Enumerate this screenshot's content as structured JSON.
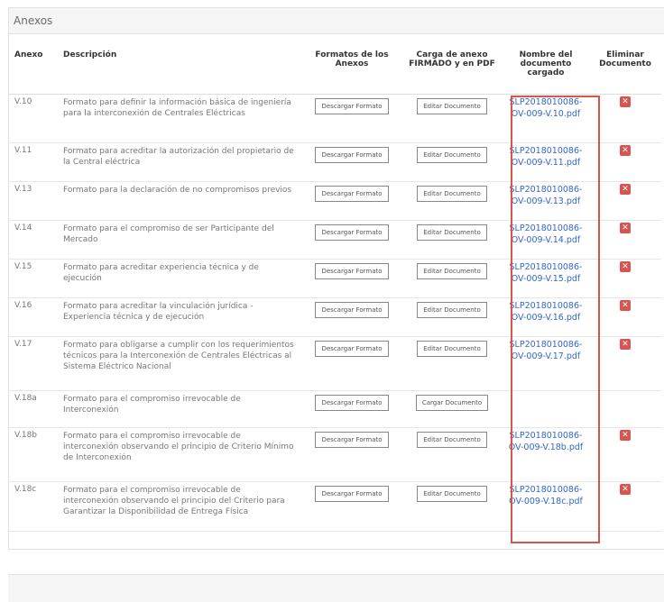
{
  "panel": {
    "title": "Anexos"
  },
  "headers": {
    "anexo": "Anexo",
    "descripcion": "Descripción",
    "formatos": "Formatos de los Anexos",
    "carga": "Carga de anexo FIRMADO y en PDF",
    "nombre": "Nombre del documento cargado",
    "eliminar": "Eliminar Documento"
  },
  "rows": [
    {
      "anexo": "V.10",
      "desc": "Formato para definir la información básica de ingeniería para la interconexión de Centrales Eléctricas",
      "fmt": "Descargar Formato",
      "carga": "Editar Documento",
      "doc": "SLP2018010086-OV-009-V.10.pdf",
      "del": "x"
    },
    {
      "anexo": "V.11",
      "desc": "Formato para acreditar la autorización del propietario de la Central eléctrica",
      "fmt": "Descargar Formato",
      "carga": "Editar Documento",
      "doc": "SLP2018010086-OV-009-V.11.pdf",
      "del": "x"
    },
    {
      "anexo": "V.13",
      "desc": "Formato para la declaración de no compromisos previos",
      "fmt": "Descargar Formato",
      "carga": "Editar Documento",
      "doc": "SLP2018010086-OV-009-V.13.pdf",
      "del": "x"
    },
    {
      "anexo": "V.14",
      "desc": "Formato para el compromiso de ser Participante del Mercado",
      "fmt": "Descargar Formato",
      "carga": "Editar Documento",
      "doc": "SLP2018010086-OV-009-V.14.pdf",
      "del": "x"
    },
    {
      "anexo": "V.15",
      "desc": "Formato para acreditar experiencia técnica y de ejecución",
      "fmt": "Descargar Formato",
      "carga": "Editar Documento",
      "doc": "SLP2018010086-OV-009-V.15.pdf",
      "del": "x"
    },
    {
      "anexo": "V.16",
      "desc": "Formato para acreditar la vinculación jurídica - Experiencia técnica y de ejecución",
      "fmt": "Descargar Formato",
      "carga": "Editar Documento",
      "doc": "SLP2018010086-OV-009-V.16.pdf",
      "del": "x"
    },
    {
      "anexo": "V.17",
      "desc": "Formato para obligarse a cumplir con los requerimientos técnicos para la Interconexión de Centrales Eléctricas al Sistema Eléctrico Nacional",
      "fmt": "Descargar Formato",
      "carga": "Editar Documento",
      "doc": "SLP2018010086-OV-009-V.17.pdf",
      "del": "x"
    },
    {
      "anexo": "V.18a",
      "desc": "Formato para el compromiso irrevocable de Interconexión",
      "fmt": "Descargar Formato",
      "carga": "Cargar Documento",
      "doc": "",
      "del": ""
    },
    {
      "anexo": "V.18b",
      "desc": "Formato para el compromiso irrevocable de interconexión observando el principio de Criterio Mínimo de Interconexión",
      "fmt": "Descargar Formato",
      "carga": "Editar Documento",
      "doc": "SLP2018010086-OV-009-V.18b.pdf",
      "del": "x"
    },
    {
      "anexo": "V.18c",
      "desc": "Formato para el compromiso irrevocable de interconexión observando el principio del Criterio para Garantizar la Disponibilidad de Entrega Física",
      "fmt": "Descargar Formato",
      "carga": "Editar Documento",
      "doc": "SLP2018010086-OV-009-V.18c.pdf",
      "del": "x"
    }
  ],
  "colors": {
    "link": "#3366cc",
    "delete": "#d9534f",
    "highlight": "#d9534f"
  },
  "icons": {
    "delete": "close-icon"
  }
}
